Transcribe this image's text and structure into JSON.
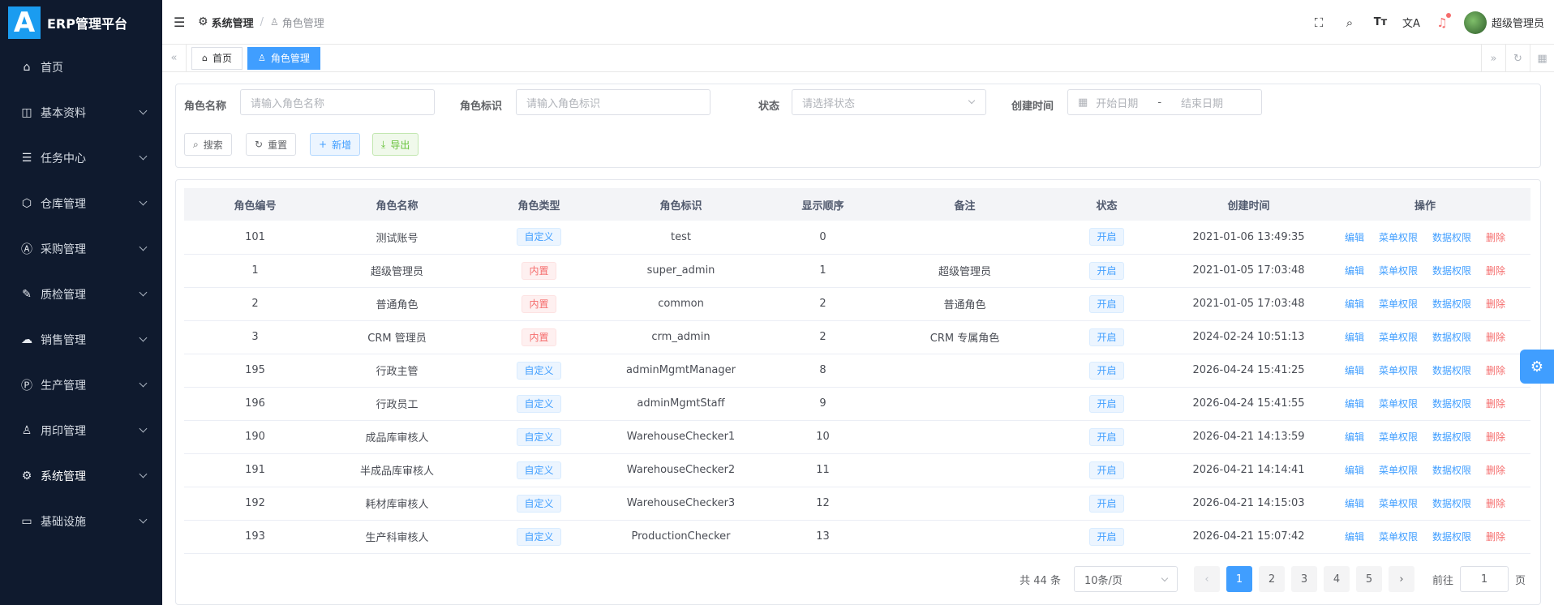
{
  "app": {
    "logo_letter": "A",
    "title": "ERP管理平台"
  },
  "sidebar": {
    "items": [
      {
        "label": "首页",
        "icon": "home-icon",
        "glyph": "⌂"
      },
      {
        "label": "基本资料",
        "icon": "document-icon",
        "glyph": "◫"
      },
      {
        "label": "任务中心",
        "icon": "server-icon",
        "glyph": "☰"
      },
      {
        "label": "仓库管理",
        "icon": "box-icon",
        "glyph": "⬡"
      },
      {
        "label": "采购管理",
        "icon": "letter-a-icon",
        "glyph": "Ⓐ"
      },
      {
        "label": "质检管理",
        "icon": "tool-icon",
        "glyph": "✎"
      },
      {
        "label": "销售管理",
        "icon": "chart-icon",
        "glyph": "☁"
      },
      {
        "label": "生产管理",
        "icon": "letter-p-icon",
        "glyph": "Ⓟ"
      },
      {
        "label": "用印管理",
        "icon": "stamp-icon",
        "glyph": "♙"
      },
      {
        "label": "系统管理",
        "icon": "gear-icon",
        "glyph": "⚙"
      },
      {
        "label": "基础设施",
        "icon": "monitor-icon",
        "glyph": "▭"
      }
    ]
  },
  "breadcrumb": {
    "parent": "系统管理",
    "separator": "/",
    "current": "角色管理"
  },
  "user": {
    "name": "超级管理员"
  },
  "tabs": [
    {
      "label": "首页"
    },
    {
      "label": "角色管理"
    }
  ],
  "search": {
    "role_name_label": "角色名称",
    "role_name_placeholder": "请输入角色名称",
    "role_key_label": "角色标识",
    "role_key_placeholder": "请输入角色标识",
    "status_label": "状态",
    "status_placeholder": "请选择状态",
    "created_label": "创建时间",
    "start_placeholder": "开始日期",
    "range_sep": "-",
    "end_placeholder": "结束日期",
    "search_btn": "搜索",
    "reset_btn": "重置",
    "add_btn": "新增",
    "export_btn": "导出"
  },
  "table": {
    "headers": [
      "角色编号",
      "角色名称",
      "角色类型",
      "角色标识",
      "显示顺序",
      "备注",
      "状态",
      "创建时间",
      "操作"
    ],
    "actions": {
      "edit": "编辑",
      "menu_perm": "菜单权限",
      "data_perm": "数据权限",
      "delete": "删除"
    },
    "rows": [
      {
        "id": "101",
        "name": "测试账号",
        "type": "自定义",
        "type_color": "blue",
        "key": "test",
        "order": "0",
        "remark": "",
        "status": "开启",
        "created": "2021-01-06 13:49:35"
      },
      {
        "id": "1",
        "name": "超级管理员",
        "type": "内置",
        "type_color": "red",
        "key": "super_admin",
        "order": "1",
        "remark": "超级管理员",
        "status": "开启",
        "created": "2021-01-05 17:03:48"
      },
      {
        "id": "2",
        "name": "普通角色",
        "type": "内置",
        "type_color": "red",
        "key": "common",
        "order": "2",
        "remark": "普通角色",
        "status": "开启",
        "created": "2021-01-05 17:03:48"
      },
      {
        "id": "3",
        "name": "CRM 管理员",
        "type": "内置",
        "type_color": "red",
        "key": "crm_admin",
        "order": "2",
        "remark": "CRM 专属角色",
        "status": "开启",
        "created": "2024-02-24 10:51:13"
      },
      {
        "id": "195",
        "name": "行政主管",
        "type": "自定义",
        "type_color": "blue",
        "key": "adminMgmtManager",
        "order": "8",
        "remark": "",
        "status": "开启",
        "created": "2026-04-24 15:41:25"
      },
      {
        "id": "196",
        "name": "行政员工",
        "type": "自定义",
        "type_color": "blue",
        "key": "adminMgmtStaff",
        "order": "9",
        "remark": "",
        "status": "开启",
        "created": "2026-04-24 15:41:55"
      },
      {
        "id": "190",
        "name": "成品库审核人",
        "type": "自定义",
        "type_color": "blue",
        "key": "WarehouseChecker1",
        "order": "10",
        "remark": "",
        "status": "开启",
        "created": "2026-04-21 14:13:59"
      },
      {
        "id": "191",
        "name": "半成品库审核人",
        "type": "自定义",
        "type_color": "blue",
        "key": "WarehouseChecker2",
        "order": "11",
        "remark": "",
        "status": "开启",
        "created": "2026-04-21 14:14:41"
      },
      {
        "id": "192",
        "name": "耗材库审核人",
        "type": "自定义",
        "type_color": "blue",
        "key": "WarehouseChecker3",
        "order": "12",
        "remark": "",
        "status": "开启",
        "created": "2026-04-21 14:15:03"
      },
      {
        "id": "193",
        "name": "生产科审核人",
        "type": "自定义",
        "type_color": "blue",
        "key": "ProductionChecker",
        "order": "13",
        "remark": "",
        "status": "开启",
        "created": "2026-04-21 15:07:42"
      }
    ]
  },
  "pagination": {
    "total_text": "共 44 条",
    "page_size": "10条/页",
    "pages": [
      "1",
      "2",
      "3",
      "4",
      "5"
    ],
    "current": "1",
    "goto_label": "前往",
    "goto_value": "1",
    "goto_suffix": "页"
  }
}
